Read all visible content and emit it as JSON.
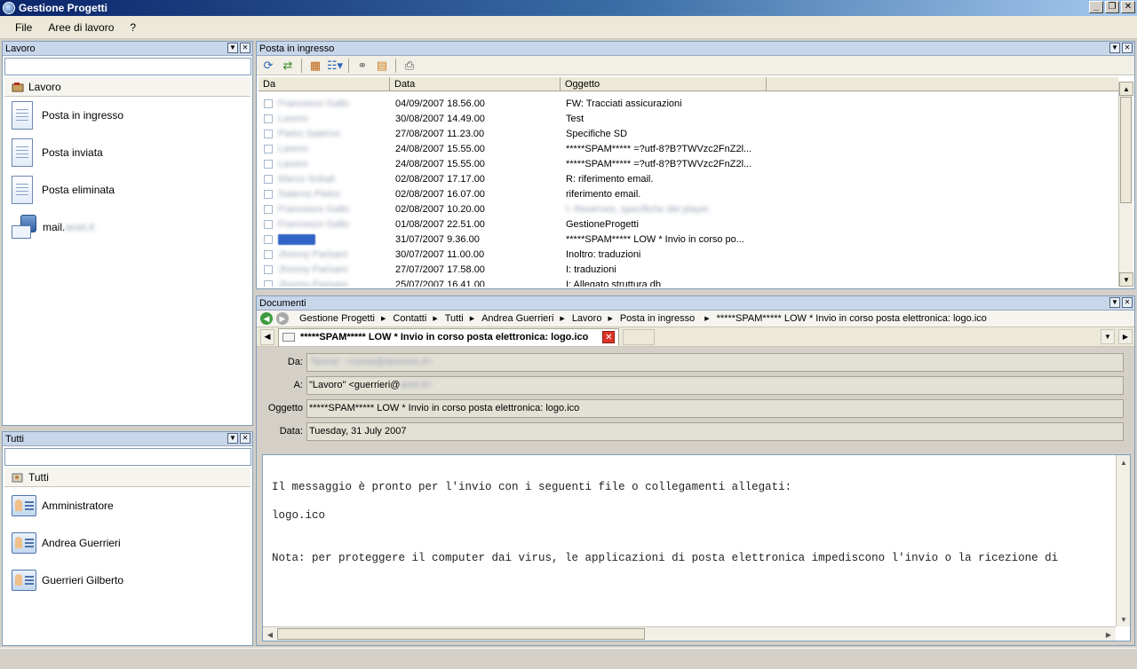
{
  "window": {
    "title": "Gestione Progetti"
  },
  "menu": {
    "items": [
      "File",
      "Aree di lavoro",
      "?"
    ]
  },
  "lavoro_panel": {
    "title": "Lavoro",
    "search_value": "",
    "root_label": "Lavoro",
    "items": [
      "Posta in ingresso",
      "Posta inviata",
      "Posta eliminata",
      "mail."
    ],
    "mail_suffix_blurred": "anet.it"
  },
  "tutti_panel": {
    "title": "Tutti",
    "search_value": "",
    "root_label": "Tutti",
    "items": [
      "Amministratore",
      "Andrea Guerrieri",
      "Guerrieri Gilberto"
    ]
  },
  "inbox_panel": {
    "title": "Posta in ingresso",
    "columns": [
      "Da",
      "Data",
      "Oggetto"
    ],
    "rows": [
      {
        "da": "Francesco Gallo",
        "data": "04/09/2007 18.56.00",
        "oggetto": "FW: Tracciati assicurazioni"
      },
      {
        "da": "Lavoro",
        "data": "30/08/2007 14.49.00",
        "oggetto": "Test"
      },
      {
        "da": "Pietro Salerno",
        "data": "27/08/2007 11.23.00",
        "oggetto": "Specifiche SD"
      },
      {
        "da": "Lavoro",
        "data": "24/08/2007 15.55.00",
        "oggetto": "*****SPAM***** =?utf-8?B?TWVzc2FnZ2l..."
      },
      {
        "da": "Lavoro",
        "data": "24/08/2007 15.55.00",
        "oggetto": "*****SPAM***** =?utf-8?B?TWVzc2FnZ2l..."
      },
      {
        "da": "Marco Sobali",
        "data": "02/08/2007 17.17.00",
        "oggetto": "R: riferimento email."
      },
      {
        "da": "Salerno Pietro",
        "data": "02/08/2007 16.07.00",
        "oggetto": "riferimento email."
      },
      {
        "da": "Francesco Gallo",
        "data": "02/08/2007 10.20.00",
        "oggetto": "I: Reserves, specifiche del player"
      },
      {
        "da": "Francesco Gallo",
        "data": "01/08/2007 22.51.00",
        "oggetto": "GestioneProgetti"
      },
      {
        "da": "Lavoro",
        "data": "31/07/2007 9.36.00",
        "oggetto": "*****SPAM***** LOW *  Invio in corso po..."
      },
      {
        "da": "Jhonny Parisani",
        "data": "30/07/2007 11.00.00",
        "oggetto": "Inoltro: traduzioni"
      },
      {
        "da": "Jhonny Parisani",
        "data": "27/07/2007 17.58.00",
        "oggetto": "I: traduzioni"
      },
      {
        "da": "Jhonny Parisani",
        "data": "25/07/2007 16.41.00",
        "oggetto": "I: Allegato struttura db"
      }
    ],
    "blurred_rows": [
      0,
      1,
      2,
      3,
      4,
      5,
      6,
      7,
      8,
      9,
      10,
      11,
      12
    ],
    "blurred_subject_rows": [
      7
    ],
    "selected_row": 9
  },
  "documents_panel": {
    "title": "Documenti",
    "breadcrumb": [
      "Gestione Progetti",
      "Contatti",
      "Tutti",
      "Andrea Guerrieri",
      "Lavoro",
      "Posta in ingresso",
      "*****SPAM***** LOW *  Invio in corso posta elettronica: logo.ico"
    ],
    "tab_label": "*****SPAM***** LOW *  Invio in corso posta elettronica: logo.ico",
    "fields": {
      "da_label": "Da:",
      "da_value": "\"Nome\" <nome@dominio.it>",
      "a_label": "A:",
      "a_value_visible": "\"Lavoro\" <guerrieri@",
      "a_value_blurred": "anet.it>",
      "oggetto_label": "Oggetto",
      "oggetto_value": "*****SPAM***** LOW *  Invio in corso posta elettronica: logo.ico",
      "data_label": "Data:",
      "data_value": "Tuesday, 31 July 2007"
    },
    "body_lines": [
      "Il messaggio è pronto per l'invio con i seguenti file o collegamenti allegati:",
      "",
      "logo.ico",
      "",
      "",
      "Nota: per proteggere il computer dai virus, le applicazioni di posta elettronica impediscono l'invio o la ricezione di"
    ]
  }
}
